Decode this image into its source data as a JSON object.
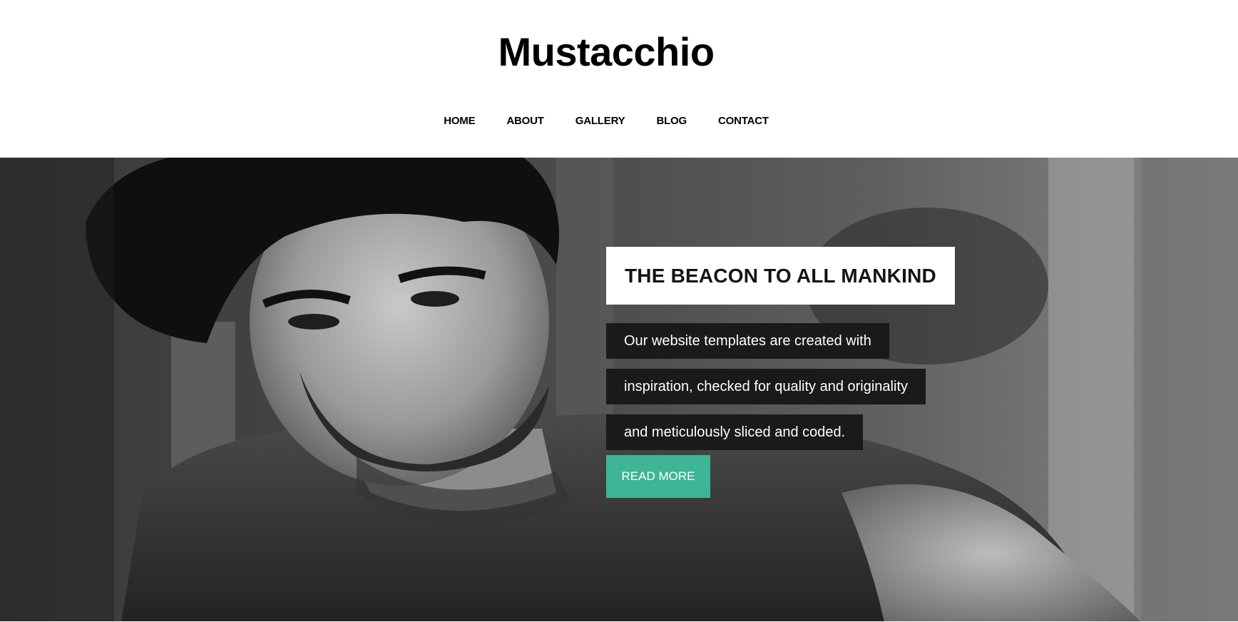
{
  "header": {
    "logo": "Mustacchio"
  },
  "nav": {
    "items": [
      {
        "label": "HOME"
      },
      {
        "label": "ABOUT"
      },
      {
        "label": "GALLERY"
      },
      {
        "label": "BLOG"
      },
      {
        "label": "CONTACT"
      }
    ]
  },
  "hero": {
    "title": "THE BEACON TO ALL MANKIND",
    "lines": [
      "Our website templates are created with",
      "inspiration, checked for quality and originality",
      "and meticulously sliced and coded."
    ],
    "button_label": "READ MORE",
    "image_icon": "portrait-photo-icon"
  },
  "colors": {
    "accent": "#3eb594",
    "text_box_background": "#1a1a1a",
    "title_box_background": "#ffffff"
  }
}
